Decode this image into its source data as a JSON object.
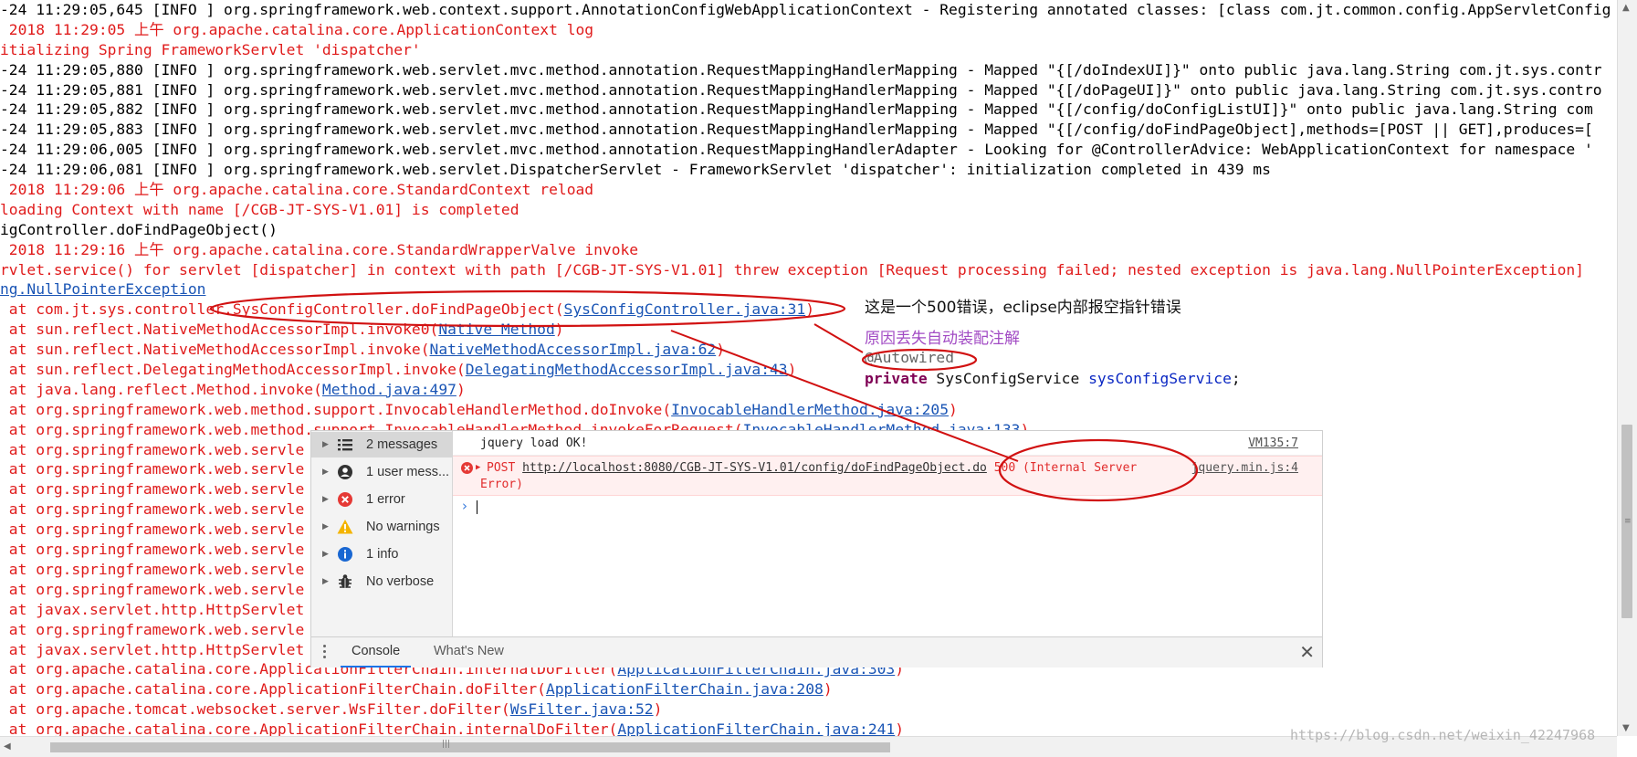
{
  "log_lines": [
    {
      "style": "info",
      "text": "-24 11:29:05,645 [INFO ] org.springframework.web.context.support.AnnotationConfigWebApplicationContext - Registering annotated classes: [class com.jt.common.config.AppServletConfig"
    },
    {
      "style": "err",
      "text": " 2018 11:29:05 上午 org.apache.catalina.core.ApplicationContext log"
    },
    {
      "style": "err",
      "text": "itializing Spring FrameworkServlet 'dispatcher'"
    },
    {
      "style": "info",
      "text": "-24 11:29:05,880 [INFO ] org.springframework.web.servlet.mvc.method.annotation.RequestMappingHandlerMapping - Mapped \"{[/doIndexUI]}\" onto public java.lang.String com.jt.sys.contr"
    },
    {
      "style": "info",
      "text": "-24 11:29:05,881 [INFO ] org.springframework.web.servlet.mvc.method.annotation.RequestMappingHandlerMapping - Mapped \"{[/doPageUI]}\" onto public java.lang.String com.jt.sys.contro"
    },
    {
      "style": "info",
      "text": "-24 11:29:05,882 [INFO ] org.springframework.web.servlet.mvc.method.annotation.RequestMappingHandlerMapping - Mapped \"{[/config/doConfigListUI]}\" onto public java.lang.String com"
    },
    {
      "style": "info",
      "text": "-24 11:29:05,883 [INFO ] org.springframework.web.servlet.mvc.method.annotation.RequestMappingHandlerMapping - Mapped \"{[/config/doFindPageObject],methods=[POST || GET],produces=["
    },
    {
      "style": "info",
      "text": "-24 11:29:06,005 [INFO ] org.springframework.web.servlet.mvc.method.annotation.RequestMappingHandlerAdapter - Looking for @ControllerAdvice: WebApplicationContext for namespace '"
    },
    {
      "style": "info",
      "text": "-24 11:29:06,081 [INFO ] org.springframework.web.servlet.DispatcherServlet - FrameworkServlet 'dispatcher': initialization completed in 439 ms"
    },
    {
      "style": "err",
      "text": " 2018 11:29:06 上午 org.apache.catalina.core.StandardContext reload"
    },
    {
      "style": "err",
      "text": "loading Context with name [/CGB-JT-SYS-V1.01] is completed"
    },
    {
      "style": "info",
      "text": "igController.doFindPageObject()"
    },
    {
      "style": "err",
      "text": " 2018 11:29:16 上午 org.apache.catalina.core.StandardWrapperValve invoke"
    },
    {
      "style": "err",
      "text": "rvlet.service() for servlet [dispatcher] in context with path [/CGB-JT-SYS-V1.01] threw exception [Request processing failed; nested exception is java.lang.NullPointerException]"
    },
    {
      "style": "err",
      "text": "",
      "link": "ng.NullPointerException"
    },
    {
      "style": "err",
      "text": " at com.jt.sys.controller.SysConfigController.doFindPageObject(",
      "link": "SysConfigController.java:31",
      "after": ")"
    },
    {
      "style": "err",
      "text": " at sun.reflect.NativeMethodAccessorImpl.invoke0(",
      "link": "Native Method",
      "after": ")"
    },
    {
      "style": "err",
      "text": " at sun.reflect.NativeMethodAccessorImpl.invoke(",
      "link": "NativeMethodAccessorImpl.java:62",
      "after": ")"
    },
    {
      "style": "err",
      "text": " at sun.reflect.DelegatingMethodAccessorImpl.invoke(",
      "link": "DelegatingMethodAccessorImpl.java:43",
      "after": ")"
    },
    {
      "style": "err",
      "text": " at java.lang.reflect.Method.invoke(",
      "link": "Method.java:497",
      "after": ")"
    },
    {
      "style": "err",
      "text": " at org.springframework.web.method.support.InvocableHandlerMethod.doInvoke(",
      "link": "InvocableHandlerMethod.java:205",
      "after": ")"
    },
    {
      "style": "err",
      "text": " at org.springframework.web.method.support.InvocableHandlerMethod.invokeForRequest(",
      "link": "InvocableHandlerMethod.java:133",
      "after": ")"
    },
    {
      "style": "err",
      "text": " at org.springframework.web.servle"
    },
    {
      "style": "err",
      "text": " at org.springframework.web.servle"
    },
    {
      "style": "err",
      "text": " at org.springframework.web.servle"
    },
    {
      "style": "err",
      "text": " at org.springframework.web.servle"
    },
    {
      "style": "err",
      "text": " at org.springframework.web.servle"
    },
    {
      "style": "err",
      "text": " at org.springframework.web.servle"
    },
    {
      "style": "err",
      "text": " at org.springframework.web.servle"
    },
    {
      "style": "err",
      "text": " at org.springframework.web.servle"
    },
    {
      "style": "err",
      "text": " at javax.servlet.http.HttpServlet"
    },
    {
      "style": "err",
      "text": " at org.springframework.web.servle"
    },
    {
      "style": "err",
      "text": " at javax.servlet.http.HttpServlet"
    },
    {
      "style": "err",
      "text": " at org.apache.catalina.core.ApplicationFilterChain.internalDoFilter(",
      "link": "ApplicationFilterChain.java:303",
      "after": ")"
    },
    {
      "style": "err",
      "text": " at org.apache.catalina.core.ApplicationFilterChain.doFilter(",
      "link": "ApplicationFilterChain.java:208",
      "after": ")"
    },
    {
      "style": "err",
      "text": " at org.apache.tomcat.websocket.server.WsFilter.doFilter(",
      "link": "WsFilter.java:52",
      "after": ")"
    },
    {
      "style": "err",
      "text": " at org.apache.catalina.core.ApplicationFilterChain.internalDoFilter(",
      "link": "ApplicationFilterChain.java:241",
      "after": ")"
    }
  ],
  "annotations": {
    "note_500": "这是一个500错误，eclipse内部报空指针错误",
    "note_reason": "原因丢失自动装配注解",
    "code_annotation": "@Autowired",
    "code_keyword": "private",
    "code_type": " SysConfigService ",
    "code_field": "sysConfigService",
    "code_end": ";"
  },
  "devtools": {
    "sidebar": [
      {
        "label": "2 messages",
        "icon": "list-icon",
        "selected": true
      },
      {
        "label": "1 user mess...",
        "icon": "user-icon",
        "selected": false
      },
      {
        "label": "1 error",
        "icon": "error-icon",
        "selected": false
      },
      {
        "label": "No warnings",
        "icon": "warning-icon",
        "selected": false
      },
      {
        "label": "1 info",
        "icon": "info-icon",
        "selected": false
      },
      {
        "label": "No verbose",
        "icon": "bug-icon",
        "selected": false
      }
    ],
    "messages": {
      "jquery_text": "jquery load OK!",
      "jquery_source": "VM135:7",
      "error_method": "POST ",
      "error_url": "http://localhost:8080/CGB-JT-SYS-V1.01/config/doFindPageObject.do",
      "error_status": " 500 (Internal Server",
      "error_status_cont": "Error)",
      "error_source": "jquery.min.js:4"
    },
    "tabs": {
      "console": "Console",
      "whats_new": "What's New"
    },
    "close_glyph": "✕"
  },
  "watermark": "https://blog.csdn.net/weixin_42247968",
  "colors": {
    "error_text": "#e01b1b",
    "link": "#1a55b5",
    "annotation_ink": "#d11111",
    "reason_purple": "#a24bc4",
    "devtools_error_bg": "#fff0f0"
  }
}
